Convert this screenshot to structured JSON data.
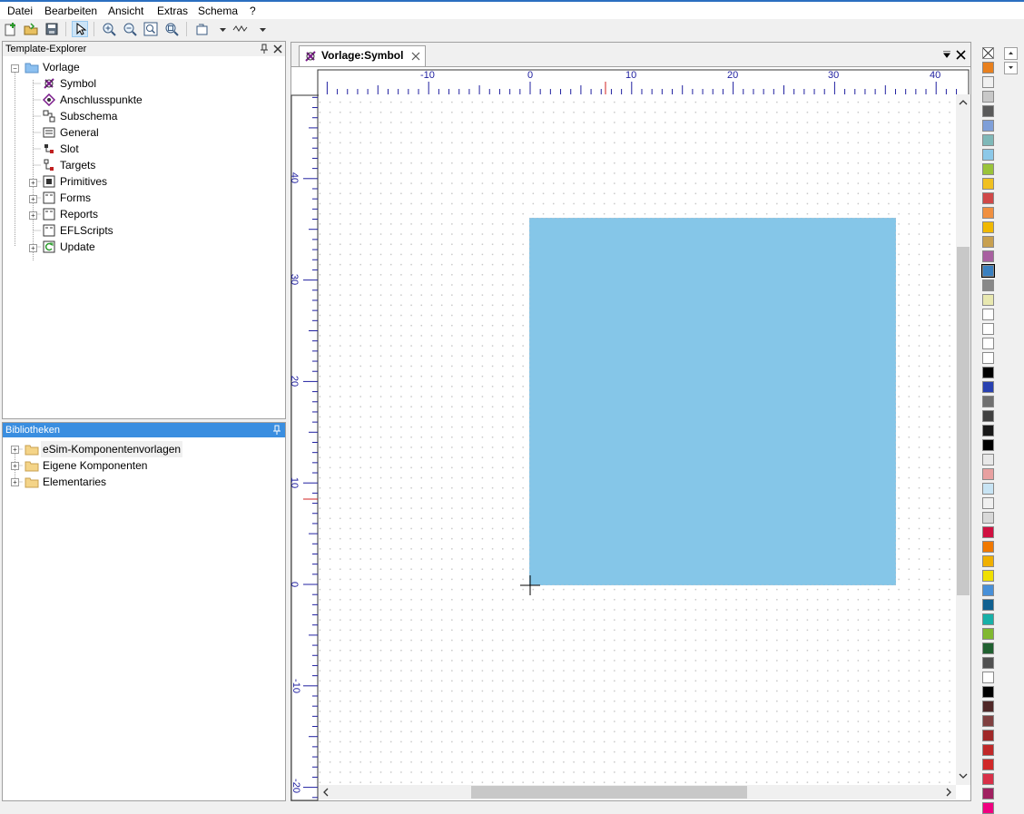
{
  "menu": [
    "Datei",
    "Bearbeiten",
    "Ansicht",
    "Extras",
    "Schema",
    "?"
  ],
  "template_explorer": {
    "title": "Template-Explorer",
    "root": "Vorlage",
    "items": [
      "Symbol",
      "Anschlusspunkte",
      "Subschema",
      "General",
      "Slot",
      "Targets",
      "Primitives",
      "Forms",
      "Reports",
      "EFLScripts",
      "Update"
    ]
  },
  "libraries": {
    "title": "Bibliotheken",
    "items": [
      "eSim-Komponentenvorlagen",
      "Eigene Komponenten",
      "Elementaries"
    ]
  },
  "document": {
    "tab_label": "Vorlage:Symbol",
    "hruler_labels": [
      "-10",
      "0",
      "10",
      "20",
      "30",
      "40"
    ],
    "vruler_labels": [
      "40",
      "30",
      "20",
      "10",
      "0",
      "-10",
      "-20"
    ]
  },
  "palette_colors": [
    "#ffffff",
    "#e8801e",
    "#f0f0f0",
    "#c8c8c8",
    "#5a5a5a",
    "#7f9fd8",
    "#7fb8b8",
    "#8cc8e8",
    "#9ac33a",
    "#f0c020",
    "#d04848",
    "#f09040",
    "#f0b800",
    "#c8a050",
    "#a860a0",
    "#3a80c0",
    "#888888",
    "#e8e8b0",
    "#ffffff",
    "#ffffff",
    "#ffffff",
    "#ffffff",
    "#000000",
    "#2840b0",
    "#707070",
    "#404040",
    "#181818",
    "#000000",
    "#e8e8e8",
    "#e8a0a0",
    "#c8e4f4",
    "#f0f0f0",
    "#d8d8d8",
    "#d01040",
    "#f07800",
    "#f0b000",
    "#f0e000",
    "#4890d8",
    "#106090",
    "#18b0a8",
    "#80b830",
    "#206030",
    "#505050",
    "#ffffff",
    "#000000",
    "#502828",
    "#804040",
    "#a02828",
    "#c02828",
    "#d02828",
    "#d83048",
    "#a02060",
    "#f00080"
  ]
}
